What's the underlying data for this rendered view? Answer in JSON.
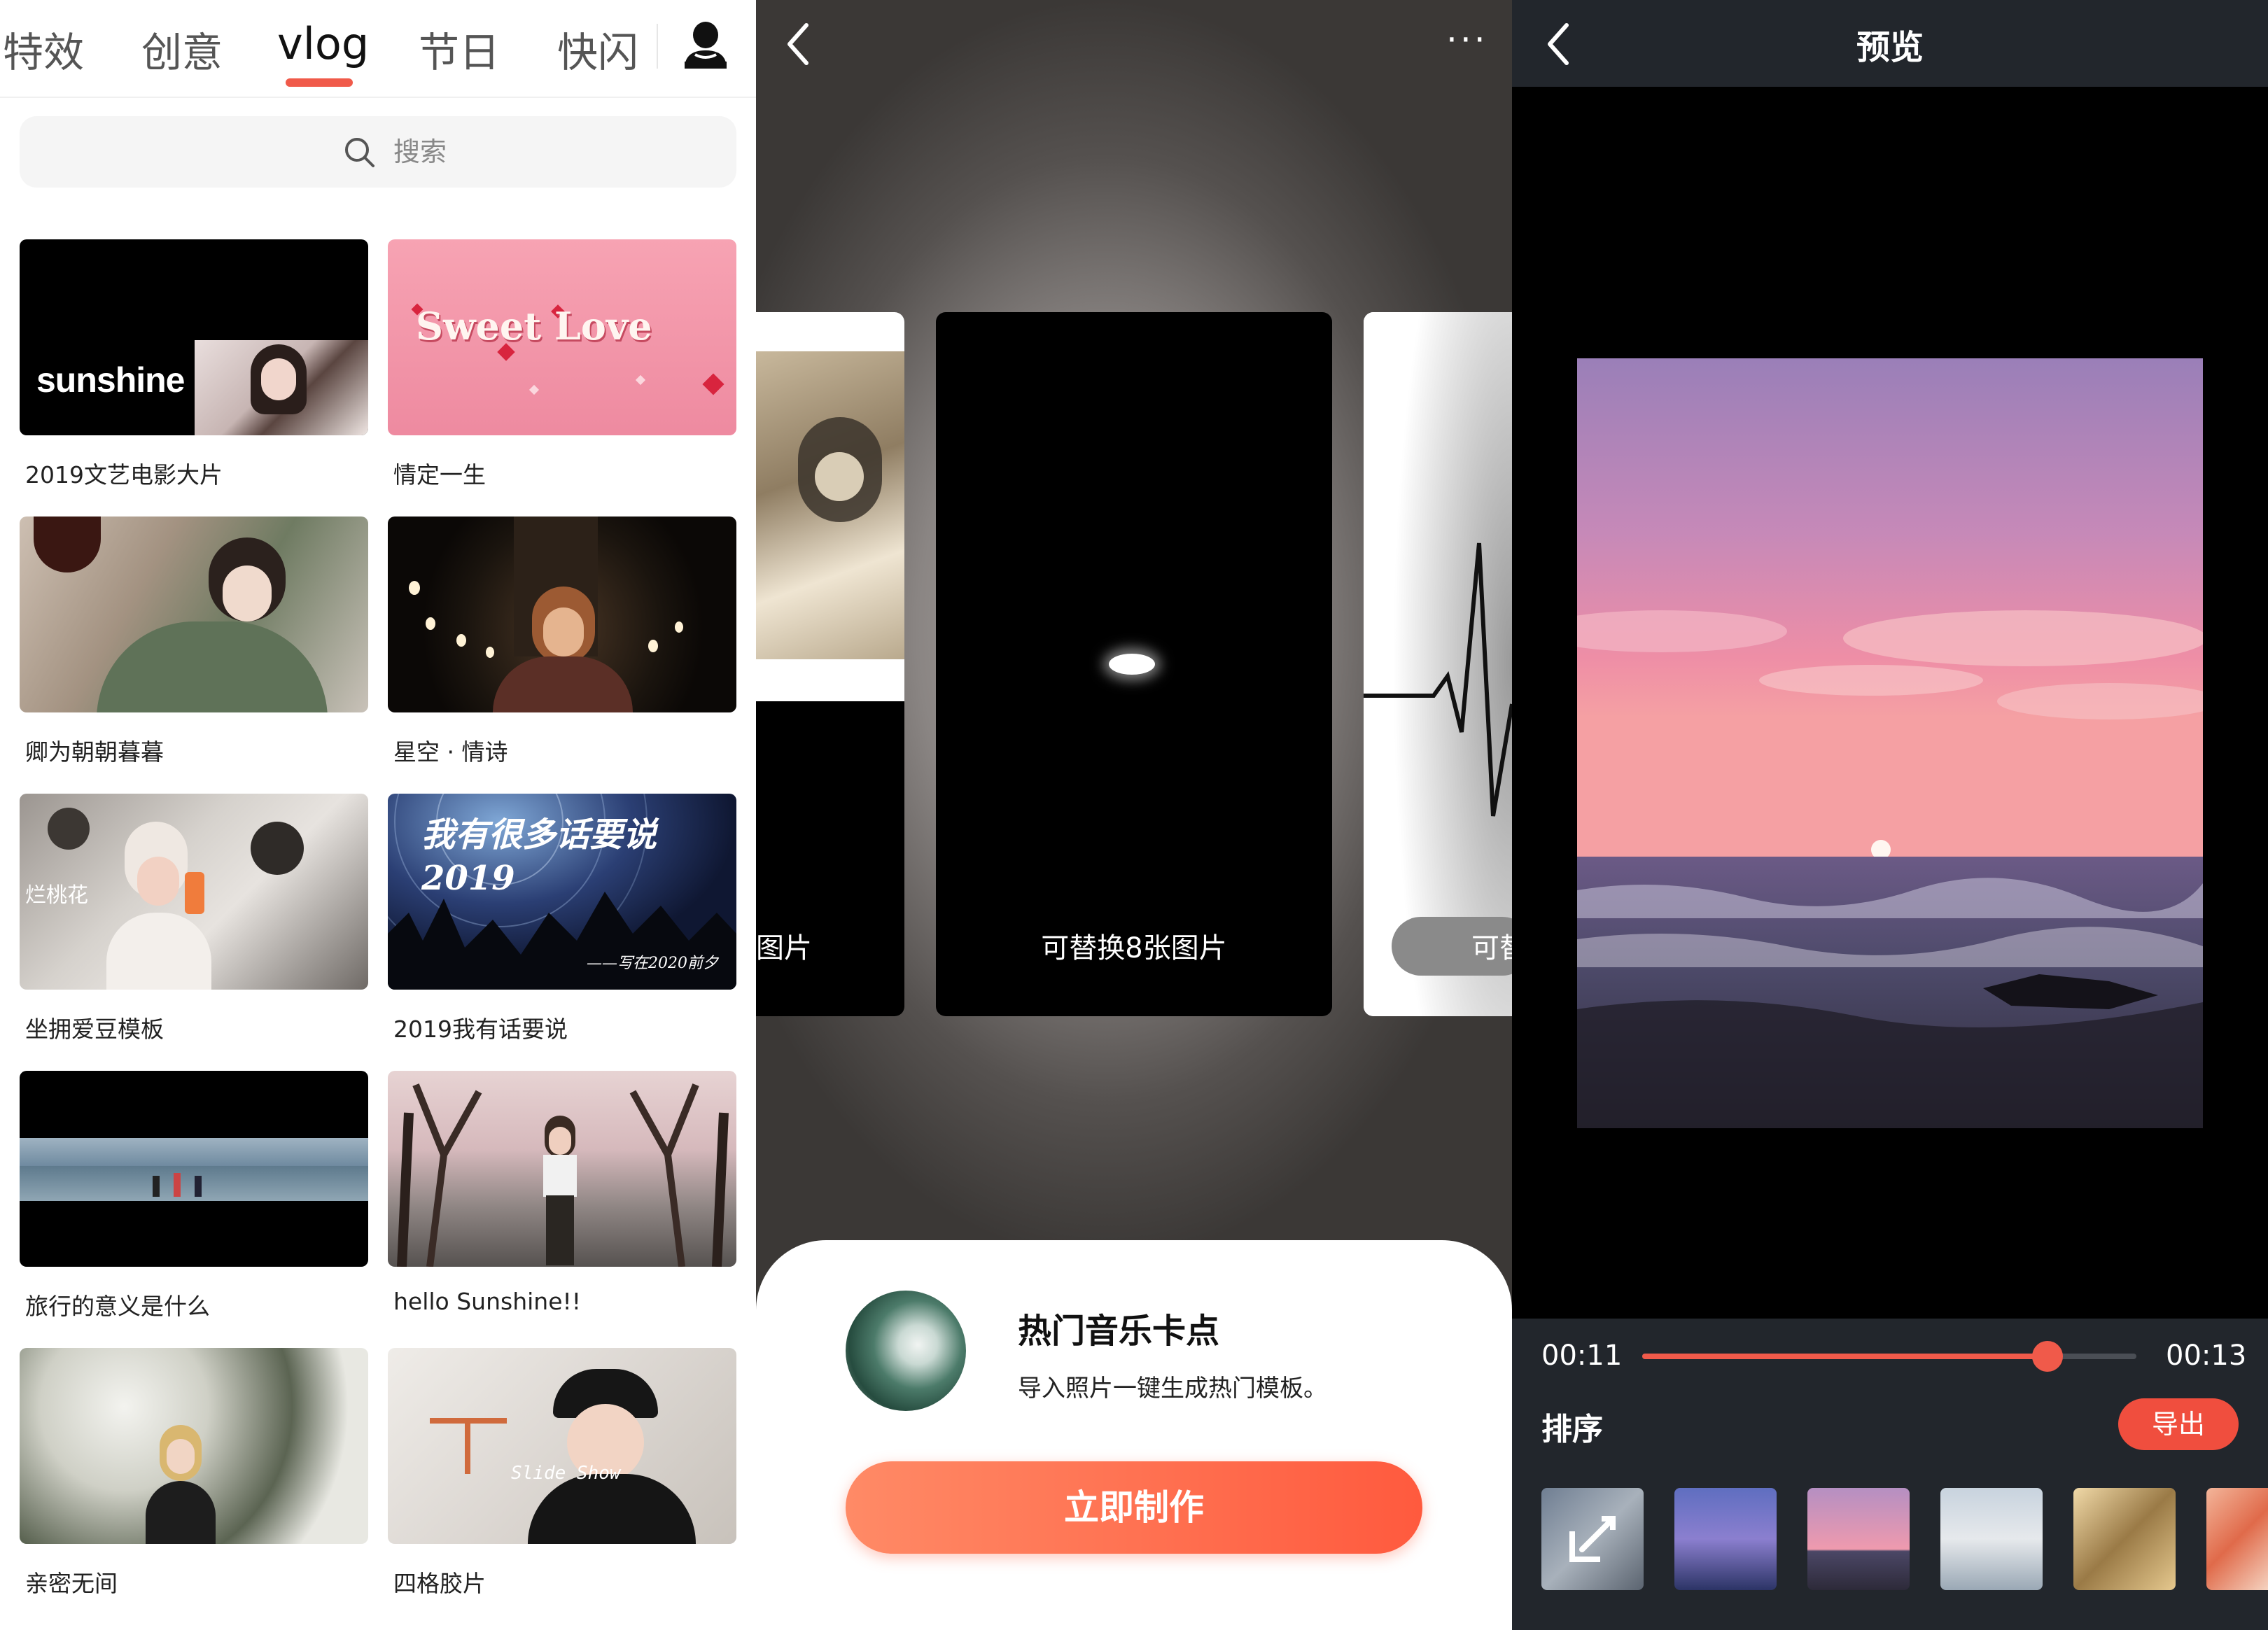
{
  "panel1": {
    "tabs": [
      "特效",
      "创意",
      "vlog",
      "节日",
      "快闪"
    ],
    "active_tab": "vlog",
    "search_placeholder": "搜索",
    "cards": [
      {
        "title": "2019文艺电影大片",
        "overlay": "sunshine"
      },
      {
        "title": "情定一生",
        "overlay": "Sweet Love"
      },
      {
        "title": "卿为朝朝暮暮",
        "overlay": ""
      },
      {
        "title": "星空 · 情诗",
        "overlay": ""
      },
      {
        "title": "坐拥爱豆模板",
        "overlay": "烂桃花"
      },
      {
        "title": "2019我有话要说",
        "overlay": "我有很多话要说 2019",
        "overlay_sub": "——写在2020前夕"
      },
      {
        "title": "旅行的意义是什么",
        "overlay": ""
      },
      {
        "title": "hello Sunshine!!",
        "overlay": ""
      },
      {
        "title": "亲密无间",
        "overlay": ""
      },
      {
        "title": "四格胶片",
        "overlay": "Slide Show"
      }
    ]
  },
  "panel2": {
    "more_label": "···",
    "slide_left_label": "图片",
    "slide_mid_label": "可替换8张图片",
    "slide_right_label": "可替",
    "sheet_title": "热门音乐卡点",
    "sheet_subtitle": "导入照片一键生成热门模板。",
    "cta_label": "立即制作"
  },
  "panel3": {
    "title": "预览",
    "time_current": "00:11",
    "time_total": "00:13",
    "progress": 0.82,
    "sort_label": "排序",
    "export_label": "导出",
    "colors": {
      "accent": "#f05a4a",
      "bar": "#22262c"
    }
  }
}
